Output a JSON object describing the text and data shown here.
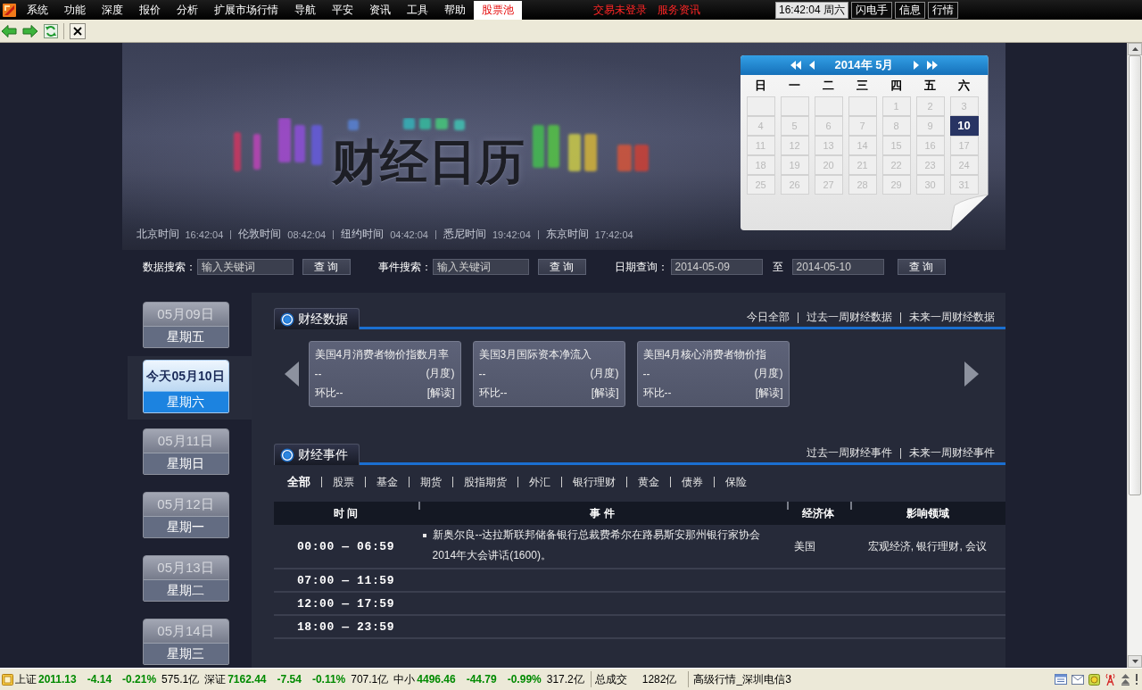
{
  "menu_bar": {
    "items": [
      {
        "label": "系统",
        "selected": false
      },
      {
        "label": "功能",
        "selected": false
      },
      {
        "label": "深度",
        "selected": false
      },
      {
        "label": "报价",
        "selected": false
      },
      {
        "label": "分析",
        "selected": false
      },
      {
        "label": "扩展市场行情",
        "selected": false
      },
      {
        "label": "导航",
        "selected": false
      },
      {
        "label": "平安",
        "selected": false
      },
      {
        "label": "资讯",
        "selected": false
      },
      {
        "label": "工具",
        "selected": false
      },
      {
        "label": "帮助",
        "selected": false
      },
      {
        "label": "股票池",
        "selected": true
      }
    ],
    "alerts": [
      "交易未登录",
      "服务资讯"
    ],
    "clock": "16:42:04 周六",
    "buttons": [
      "闪电手",
      "信息",
      "行情"
    ]
  },
  "banner": {
    "title": "财经日历",
    "clocks": [
      {
        "city": "北京时间",
        "time": "16:42:04"
      },
      {
        "city": "伦敦时间",
        "time": "08:42:04"
      },
      {
        "city": "纽约时间",
        "time": "04:42:04"
      },
      {
        "city": "悉尼时间",
        "time": "19:42:04"
      },
      {
        "city": "东京时间",
        "time": "17:42:04"
      }
    ]
  },
  "calendar": {
    "month": "2014年 5月",
    "weekdays": [
      "日",
      "一",
      "二",
      "三",
      "四",
      "五",
      "六"
    ],
    "weeks": [
      [
        {
          "kind": "blank"
        },
        {
          "kind": "blank"
        },
        {
          "kind": "blank"
        },
        {
          "kind": "blank"
        },
        {
          "kind": "day",
          "label": "1",
          "selected": false
        },
        {
          "kind": "day",
          "label": "2",
          "selected": false
        },
        {
          "kind": "day",
          "label": "3",
          "selected": false
        }
      ],
      [
        {
          "kind": "day",
          "label": "4",
          "selected": false
        },
        {
          "kind": "day",
          "label": "5",
          "selected": false
        },
        {
          "kind": "day",
          "label": "6",
          "selected": false
        },
        {
          "kind": "day",
          "label": "7",
          "selected": false
        },
        {
          "kind": "day",
          "label": "8",
          "selected": false
        },
        {
          "kind": "day",
          "label": "9",
          "selected": false
        },
        {
          "kind": "day",
          "label": "10",
          "selected": true
        }
      ],
      [
        {
          "kind": "day",
          "label": "11",
          "selected": false
        },
        {
          "kind": "day",
          "label": "12",
          "selected": false
        },
        {
          "kind": "day",
          "label": "13",
          "selected": false
        },
        {
          "kind": "day",
          "label": "14",
          "selected": false
        },
        {
          "kind": "day",
          "label": "15",
          "selected": false
        },
        {
          "kind": "day",
          "label": "16",
          "selected": false
        },
        {
          "kind": "day",
          "label": "17",
          "selected": false
        }
      ],
      [
        {
          "kind": "day",
          "label": "18",
          "selected": false
        },
        {
          "kind": "day",
          "label": "19",
          "selected": false
        },
        {
          "kind": "day",
          "label": "20",
          "selected": false
        },
        {
          "kind": "day",
          "label": "21",
          "selected": false
        },
        {
          "kind": "day",
          "label": "22",
          "selected": false
        },
        {
          "kind": "day",
          "label": "23",
          "selected": false
        },
        {
          "kind": "day",
          "label": "24",
          "selected": false
        }
      ],
      [
        {
          "kind": "day",
          "label": "25",
          "selected": false
        },
        {
          "kind": "day",
          "label": "26",
          "selected": false
        },
        {
          "kind": "day",
          "label": "27",
          "selected": false
        },
        {
          "kind": "day",
          "label": "28",
          "selected": false
        },
        {
          "kind": "day",
          "label": "29",
          "selected": false
        },
        {
          "kind": "day",
          "label": "30",
          "selected": false
        },
        {
          "kind": "day",
          "label": "31",
          "selected": false
        }
      ]
    ]
  },
  "search": {
    "data_search": {
      "label": "数据搜索：",
      "placeholder": "输入关键词",
      "button": "查 询"
    },
    "event_search": {
      "label": "事件搜索：",
      "placeholder": "输入关键词",
      "button": "查 询"
    },
    "date_query": {
      "label": "日期查询：",
      "from": "2014-05-09",
      "separator": "至",
      "to": "2014-05-10",
      "button": "查 询"
    }
  },
  "day_list": [
    {
      "date": "05月09日",
      "weekday": "星期五",
      "selected": false
    },
    {
      "date": "今天05月10日",
      "weekday": "星期六",
      "selected": true
    },
    {
      "date": "05月11日",
      "weekday": "星期日",
      "selected": false
    },
    {
      "date": "05月12日",
      "weekday": "星期一",
      "selected": false
    },
    {
      "date": "05月13日",
      "weekday": "星期二",
      "selected": false
    },
    {
      "date": "05月14日",
      "weekday": "星期三",
      "selected": false
    }
  ],
  "data_section": {
    "title": "财经数据",
    "links": [
      "今日全部",
      "过去一周财经数据",
      "未来一周财经数据"
    ],
    "cards": [
      {
        "title": "美国4月消费者物价指数月率",
        "value": "--",
        "period": "(月度)",
        "change": "环比--",
        "action": "[解读]"
      },
      {
        "title": "美国3月国际资本净流入",
        "value": "--",
        "period": "(月度)",
        "change": "环比--",
        "action": "[解读]"
      },
      {
        "title": "美国4月核心消费者物价指",
        "value": "--",
        "period": "(月度)",
        "change": "环比--",
        "action": "[解读]"
      }
    ]
  },
  "event_section": {
    "title": "财经事件",
    "links": [
      "过去一周财经事件",
      "未来一周财经事件"
    ],
    "filters": [
      {
        "label": "全部",
        "selected": true
      },
      {
        "label": "股票",
        "selected": false
      },
      {
        "label": "基金",
        "selected": false
      },
      {
        "label": "期货",
        "selected": false
      },
      {
        "label": "股指期货",
        "selected": false
      },
      {
        "label": "外汇",
        "selected": false
      },
      {
        "label": "银行理财",
        "selected": false
      },
      {
        "label": "黄金",
        "selected": false
      },
      {
        "label": "债券",
        "selected": false
      },
      {
        "label": "保险",
        "selected": false
      }
    ],
    "table": {
      "columns": [
        "时 间",
        "事 件",
        "经济体",
        "影响领域"
      ],
      "rows": [
        {
          "time": "00:00 — 06:59",
          "event": "新奥尔良--达拉斯联邦储备银行总裁费希尔在路易斯安那州银行家协会2014年大会讲话(1600)。",
          "economy": "美国",
          "impact": "宏观经济, 银行理财, 会议"
        },
        {
          "time": "07:00 — 11:59"
        },
        {
          "time": "12:00 — 17:59"
        },
        {
          "time": "18:00 — 23:59"
        }
      ]
    }
  },
  "status_bar": {
    "indices": [
      {
        "name": "上证",
        "value": "2011.13",
        "change": "-4.14",
        "percent": "-0.21%",
        "volume": "575.1亿"
      },
      {
        "name": "深证",
        "value": "7162.44",
        "change": "-7.54",
        "percent": "-0.11%",
        "volume": "707.1亿"
      },
      {
        "name": "中小",
        "value": "4496.46",
        "change": "-44.79",
        "percent": "-0.99%",
        "volume": "317.2亿"
      }
    ],
    "total_label": "总成交",
    "total": "1282亿",
    "server": "高级行情_深圳电信3"
  }
}
